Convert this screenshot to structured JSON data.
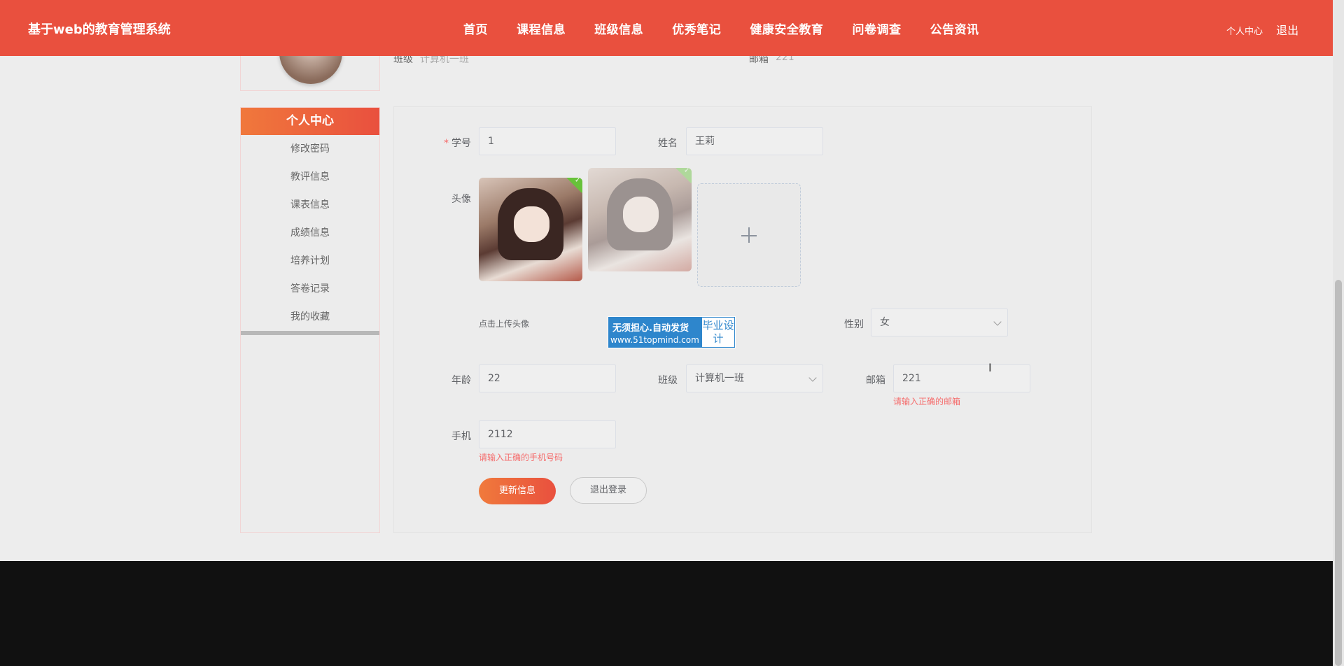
{
  "header": {
    "brand": "基于web的教育管理系统",
    "nav": [
      "首页",
      "课程信息",
      "班级信息",
      "优秀笔记",
      "健康安全教育",
      "问卷调查",
      "公告资讯"
    ],
    "user_center": "个人中心",
    "logout": "退出"
  },
  "profile_strip": {
    "class_label": "班级",
    "class_value": "计算机一班",
    "email_label": "邮箱",
    "email_value": "221"
  },
  "sidebar": {
    "title": "个人中心",
    "items": [
      "修改密码",
      "教评信息",
      "课表信息",
      "成绩信息",
      "培养计划",
      "答卷记录",
      "我的收藏"
    ]
  },
  "form": {
    "required_mark": "*",
    "student_id_label": "学号",
    "student_id_value": "1",
    "name_label": "姓名",
    "name_value": "王莉",
    "avatar_label": "头像",
    "avatar_hint": "点击上传头像",
    "gender_label": "性别",
    "gender_value": "女",
    "age_label": "年龄",
    "age_value": "22",
    "class_label": "班级",
    "class_value": "计算机一班",
    "email_label": "邮箱",
    "email_value": "221",
    "email_error": "请输入正确的邮箱",
    "phone_label": "手机",
    "phone_value": "2112",
    "phone_error": "请输入正确的手机号码",
    "update_button": "更新信息",
    "logout_button": "退出登录"
  },
  "watermark": {
    "main": "无须担心.自动发货",
    "url": "www.51topmind.com",
    "side": "毕业设计"
  }
}
